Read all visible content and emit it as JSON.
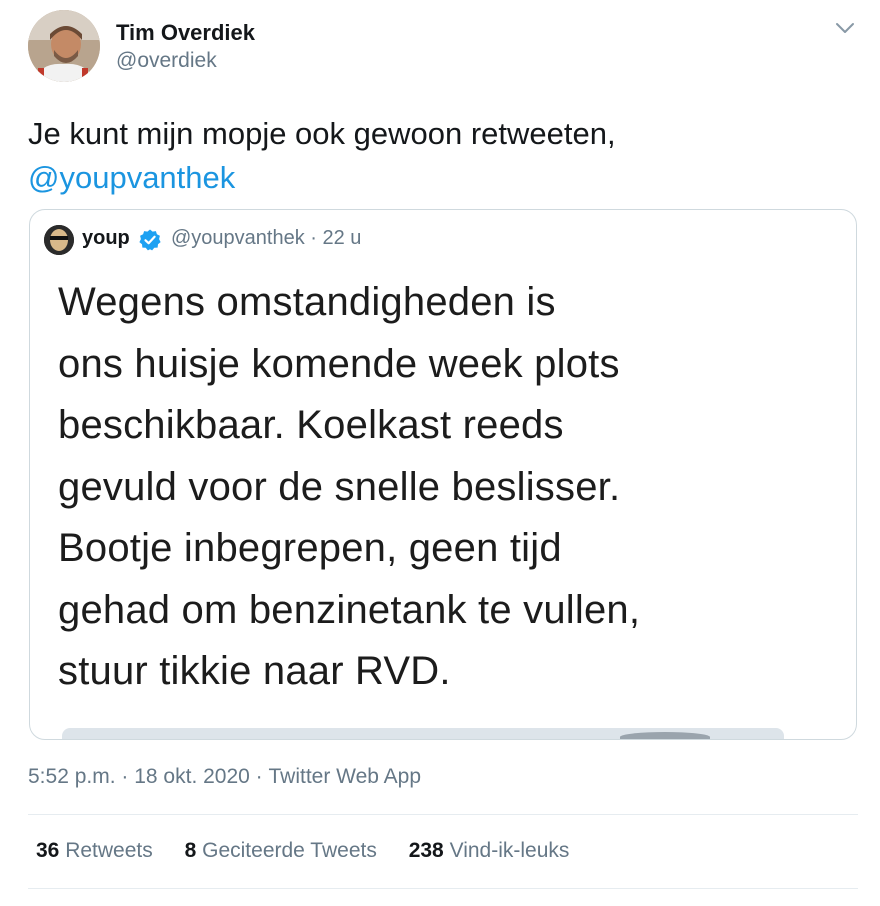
{
  "author": {
    "name": "Tim Overdiek",
    "handle": "@overdiek"
  },
  "tweet": {
    "text": "Je kunt mijn mopje ook gewoon retweeten,",
    "mention": "@youpvanthek"
  },
  "quoted_tweet": {
    "name": "youp",
    "handle_time": "@youpvanthek · 22 u",
    "image_text": [
      "Wegens omstandigheden is",
      "ons huisje komende week plots",
      "beschikbaar. Koelkast reeds",
      "gevuld voor de snelle beslisser.",
      "Bootje inbegrepen, geen tijd",
      "gehad om benzinetank te vullen,",
      "stuur tikkie naar RVD."
    ]
  },
  "meta": {
    "time": "5:52 p.m.",
    "sep1": " · ",
    "date": "18 okt. 2020",
    "sep2": " · ",
    "app": "Twitter Web App"
  },
  "stats": {
    "retweets": {
      "count": "36",
      "label": "Retweets"
    },
    "quotes": {
      "count": "8",
      "label": "Geciteerde Tweets"
    },
    "likes": {
      "count": "238",
      "label": "Vind-ik-leuks"
    }
  },
  "colors": {
    "link": "#1b95e0",
    "secondary": "#657786",
    "verified": "#1da1f2"
  }
}
